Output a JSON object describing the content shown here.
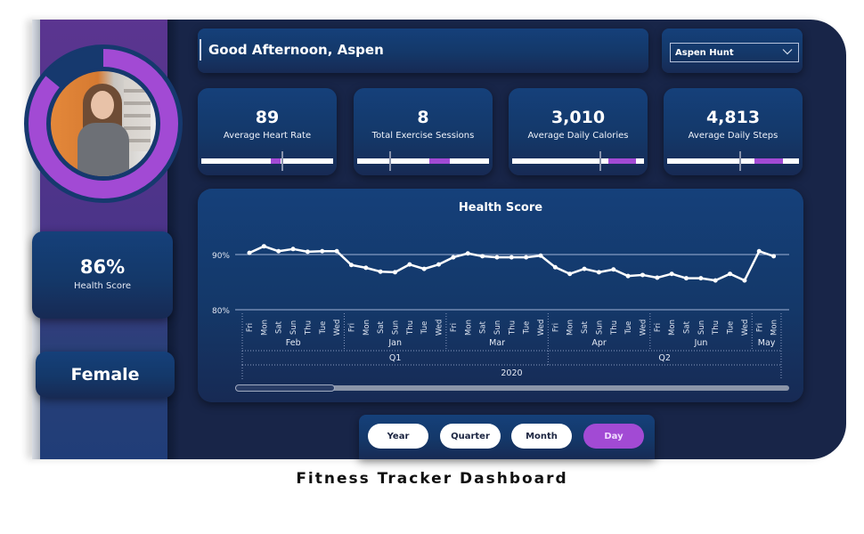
{
  "header": {
    "greeting": "Good Afternoon, Aspen",
    "user_select": {
      "selected": "Aspen Hunt",
      "icon": "chevron-down-icon"
    }
  },
  "profile": {
    "photo_alt": "Profile photo of Aspen",
    "ring_progress_percent": 86,
    "ring_color": "#a24ad4",
    "ring_track_color": "#16396e"
  },
  "sidebar": {
    "health_score": {
      "value": "86%",
      "label": "Health Score"
    },
    "gender": "Female"
  },
  "kpis": [
    {
      "value": "89",
      "label": "Average Heart Rate",
      "bar_fill_range": [
        0.53,
        0.6
      ],
      "target_marker": 0.61
    },
    {
      "value": "8",
      "label": "Total Exercise Sessions",
      "bar_fill_range": [
        0.55,
        0.7
      ],
      "target_marker": 0.24
    },
    {
      "value": "3,010",
      "label": "Average Daily Calories",
      "bar_fill_range": [
        0.73,
        0.94
      ],
      "target_marker": 0.66
    },
    {
      "value": "4,813",
      "label": "Average Daily Steps",
      "bar_fill_range": [
        0.66,
        0.88
      ],
      "target_marker": 0.55
    }
  ],
  "colors": {
    "accent": "#a24ad4",
    "background": "#182548",
    "card": "#143869",
    "sidebar": "#5b3590"
  },
  "chart_data": {
    "type": "line",
    "title": "Health Score",
    "xlabel": "",
    "ylabel": "",
    "ylim": [
      80,
      92
    ],
    "yticks": [
      "80%",
      "90%"
    ],
    "ytick_values": [
      80,
      90
    ],
    "grid": true,
    "legend": "none",
    "x_hierarchy": {
      "year": "2020",
      "quarters": [
        {
          "label": "Q1",
          "months": [
            "Feb",
            "Jan",
            "Mar"
          ]
        },
        {
          "label": "Q2",
          "months": [
            "Apr",
            "Jun",
            "May"
          ]
        }
      ]
    },
    "months": [
      {
        "month": "Feb",
        "days": [
          "Fri",
          "Mon",
          "Sat",
          "Sun",
          "Thu",
          "Tue",
          "Wed"
        ],
        "values": [
          90.3,
          91.5,
          90.6,
          91.0,
          90.5,
          90.6,
          90.6
        ]
      },
      {
        "month": "Jan",
        "days": [
          "Fri",
          "Mon",
          "Sat",
          "Sun",
          "Thu",
          "Tue",
          "Wed"
        ],
        "values": [
          88.1,
          87.6,
          86.9,
          86.8,
          88.2,
          87.4,
          88.2
        ]
      },
      {
        "month": "Mar",
        "days": [
          "Fri",
          "Mon",
          "Sat",
          "Sun",
          "Thu",
          "Tue",
          "Wed"
        ],
        "values": [
          89.5,
          90.2,
          89.7,
          89.5,
          89.5,
          89.5,
          89.8
        ]
      },
      {
        "month": "Apr",
        "days": [
          "Fri",
          "Mon",
          "Sat",
          "Sun",
          "Thu",
          "Tue",
          "Wed"
        ],
        "values": [
          87.7,
          86.5,
          87.4,
          86.8,
          87.3,
          86.1,
          86.3
        ]
      },
      {
        "month": "Jun",
        "days": [
          "Fri",
          "Mon",
          "Sat",
          "Sun",
          "Thu",
          "Tue",
          "Wed"
        ],
        "values": [
          85.8,
          86.5,
          85.7,
          85.7,
          85.3,
          86.5,
          85.3
        ]
      },
      {
        "month": "May",
        "days": [
          "Fri",
          "Mon"
        ],
        "values": [
          90.6,
          89.7
        ]
      }
    ],
    "scroll_position_fraction": 0.18
  },
  "drill_buttons": [
    {
      "label": "Year",
      "active": false
    },
    {
      "label": "Quarter",
      "active": false
    },
    {
      "label": "Month",
      "active": false
    },
    {
      "label": "Day",
      "active": true
    }
  ],
  "caption": "Fitness Tracker Dashboard"
}
